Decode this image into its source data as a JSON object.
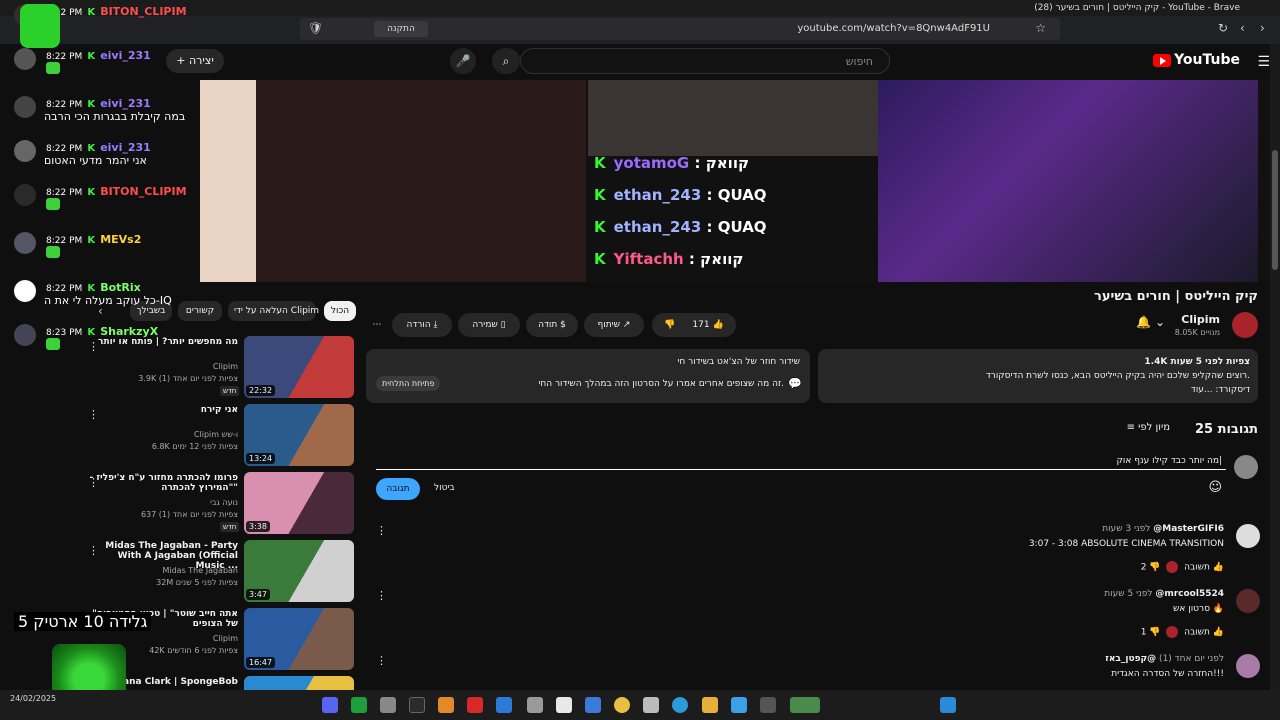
{
  "browser": {
    "window_title": "(28) קיק הייליטס | חורים בשיער - YouTube - Brave",
    "url": "youtube.com/watch?v=8Qnw4AdF91U",
    "install_label": "התקנה"
  },
  "header": {
    "search_placeholder": "חיפוש",
    "create_label": "+ יצירה",
    "logo_text": "YouTube"
  },
  "video_overlay_chat": [
    {
      "name": "yotamoG",
      "msg": "קוואק",
      "color": "n1"
    },
    {
      "name": "ethan_243",
      "msg": "QUAQ",
      "color": "n2"
    },
    {
      "name": "ethan_243",
      "msg": "QUAQ",
      "color": "n2"
    },
    {
      "name": "Yiftachh",
      "msg": "קוואק",
      "color": "n3"
    }
  ],
  "video": {
    "title": "קיק הייליטס | חורים בשיער",
    "channel": "Clipim",
    "subs": "8.05K מנויים",
    "likes": "171",
    "share": "שיתוף",
    "thanks": "תודה",
    "save": "שמירה",
    "download": "הורדה"
  },
  "description": {
    "line1": "1.4K צפיות  לפני 5 שעות",
    "line2": "רוצים שהקליפ שלכם יהיה בקיק הייליטס הבא, כנסו לשרת הדיסקורד.",
    "line3": "דיסקורד: ...עוד"
  },
  "ai_box": {
    "line1": "שידור חוזר של הצ'אט בשידור חי",
    "line2": "זה מה שצופים אחרים אמרו על הסרטון הזה במהלך השידור החי.",
    "open_label": "פתיחת התלחית"
  },
  "comments": {
    "count": "25 תגובות",
    "sort": "מיון לפי",
    "input_text": "מה יותר כבד קילו ענף אוק|",
    "reply": "תגובה",
    "cancel": "ביטול",
    "items": [
      {
        "user": "@MasterGIFI6",
        "time": "לפני 3 שעות",
        "text": "3:07 - 3:08 ABSOLUTE CINEMA TRANSITION",
        "likes": "2",
        "reply": "תשובה"
      },
      {
        "user": "@mrcool5524",
        "time": "לפני 5 שעות",
        "text": "סרטון אש 🔥",
        "likes": "1",
        "reply": "תשובה"
      },
      {
        "user": "@קפטן_באז",
        "time": "לפני יום אחד (1)",
        "text": "החזרה של הסדרה האגדית!!!",
        "likes": "",
        "reply": ""
      }
    ]
  },
  "chips": [
    "הכול",
    "העלאה על ידי Clipim",
    "קשורים",
    "בשבילך"
  ],
  "related": [
    {
      "title": "מה מחפשים יותר? | פותח או יותר",
      "channel": "Clipim",
      "meta": "3.9K צפיות  לפני יום אחד (1)",
      "badge": "חדש",
      "duration": "22:32",
      "c1": "#3b4a7a",
      "c2": "#c23a3a"
    },
    {
      "title": "אני קירח",
      "channel": "Clipim ו-שש",
      "meta": "6.8K צפיות  לפני 12 ימים",
      "badge": "",
      "duration": "13:24",
      "c1": "#2b5b8a",
      "c2": "#a06a4a"
    },
    {
      "title": "פרומו להכתרה מחזור ע\"ח צ'יפליז - \"המירוץ להכתרה\"",
      "channel": "נועה גבי",
      "meta": "637 צפיות  לפני יום אחד (1)",
      "badge": "חדש",
      "duration": "3:38",
      "c1": "#d98fb0",
      "c2": "#4a2a3a"
    },
    {
      "title": "Midas The Jagaban - Party With A Jagaban (Official Music ...",
      "channel": "Midas The Jagaban",
      "meta": "32M צפיות  לפני 5 שנים",
      "badge": "",
      "duration": "3:47",
      "c1": "#3a7a3a",
      "c2": "#d0d0d0"
    },
    {
      "title": "\"אתה חייב שוטר\" | טכאי הסטאפים של הצופים",
      "channel": "Clipim",
      "meta": "42K צפיות  לפני 6 חודשים",
      "badge": "",
      "duration": "16:47",
      "c1": "#2a5aa0",
      "c2": "#7a5a4a"
    },
    {
      "title": "Tatiana Clark | SpongeBob",
      "channel": "",
      "meta": "",
      "badge": "",
      "duration": "",
      "c1": "#2a8ad0",
      "c2": "#e8c040"
    }
  ],
  "left_chat": [
    {
      "time": "8:22 PM",
      "name": "BITON_CLIPIM",
      "msg": "",
      "color": "#ff4d4d"
    },
    {
      "time": "8:22 PM",
      "name": "eivi_231",
      "msg": "",
      "color": "#9b7cff"
    },
    {
      "time": "8:22 PM",
      "name": "eivi_231",
      "msg": "במה קיבלת בבגרות הכי הרבה",
      "color": "#9b7cff"
    },
    {
      "time": "8:22 PM",
      "name": "eivi_231",
      "msg": "אני יהמר מדעי האטום",
      "color": "#9b7cff"
    },
    {
      "time": "8:22 PM",
      "name": "BITON_CLIPIM",
      "msg": "",
      "color": "#ff4d4d"
    },
    {
      "time": "8:22 PM",
      "name": "MEVs2",
      "msg": "",
      "color": "#ffd23c"
    },
    {
      "time": "8:22 PM",
      "name": "BotRix",
      "msg": "כל עוקב מעלה לי את ה-IQ",
      "color": "#7dff6b"
    },
    {
      "time": "8:23 PM",
      "name": "SharkzyX",
      "msg": "",
      "color": "#7dff6b"
    }
  ],
  "overlay_banner": "גלידה 10 ארטיק 5",
  "taskbar_date": "24/02/2025"
}
